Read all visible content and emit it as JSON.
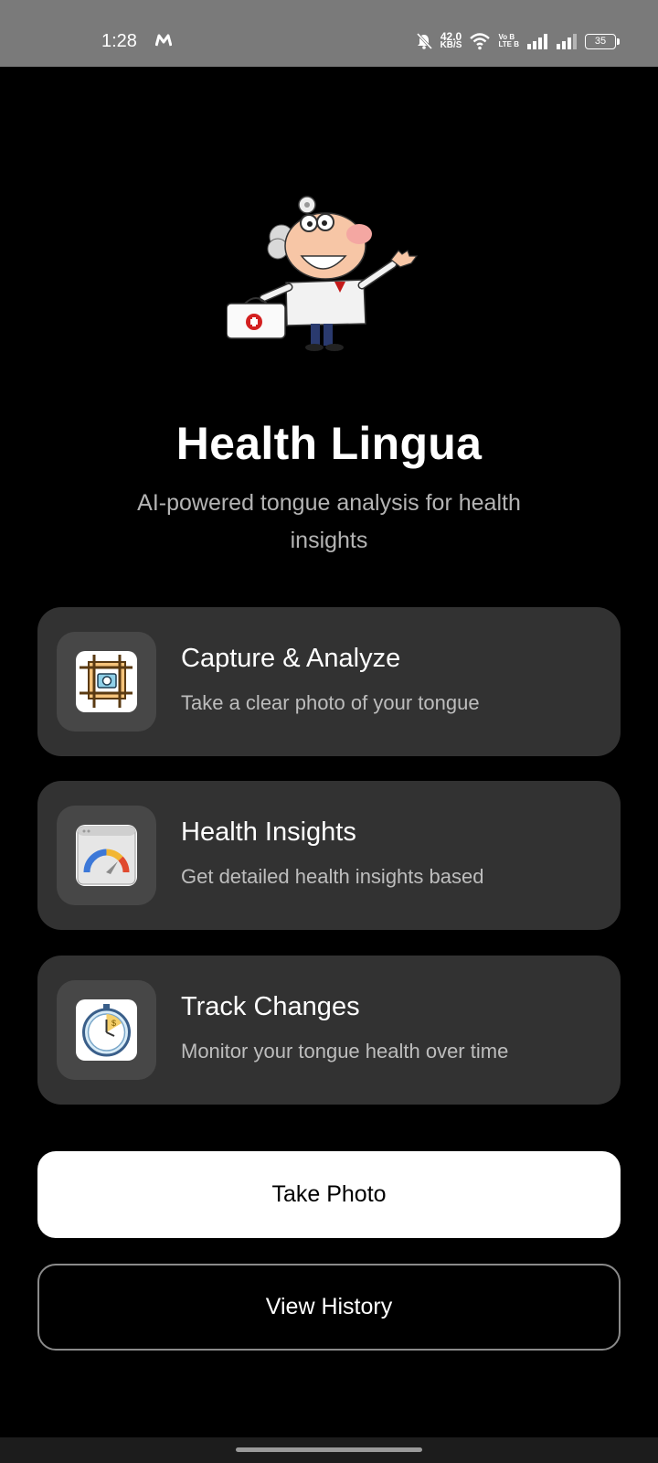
{
  "status_bar": {
    "time": "1:28",
    "speed_value": "42.0",
    "speed_unit": "KB/S",
    "volte_top": "Vo B",
    "volte_bottom": "LTE B",
    "battery": "35"
  },
  "app": {
    "title": "Health Lingua",
    "subtitle": "AI-powered tongue analysis for health insights"
  },
  "features": [
    {
      "title": "Capture & Analyze",
      "description": "Take a clear photo of your tongue",
      "icon": "camera-frame-icon"
    },
    {
      "title": "Health Insights",
      "description": "Get detailed health insights based",
      "icon": "gauge-dashboard-icon"
    },
    {
      "title": "Track Changes",
      "description": "Monitor your tongue health over time",
      "icon": "stopwatch-icon"
    }
  ],
  "actions": {
    "take_photo": "Take Photo",
    "view_history": "View History"
  }
}
